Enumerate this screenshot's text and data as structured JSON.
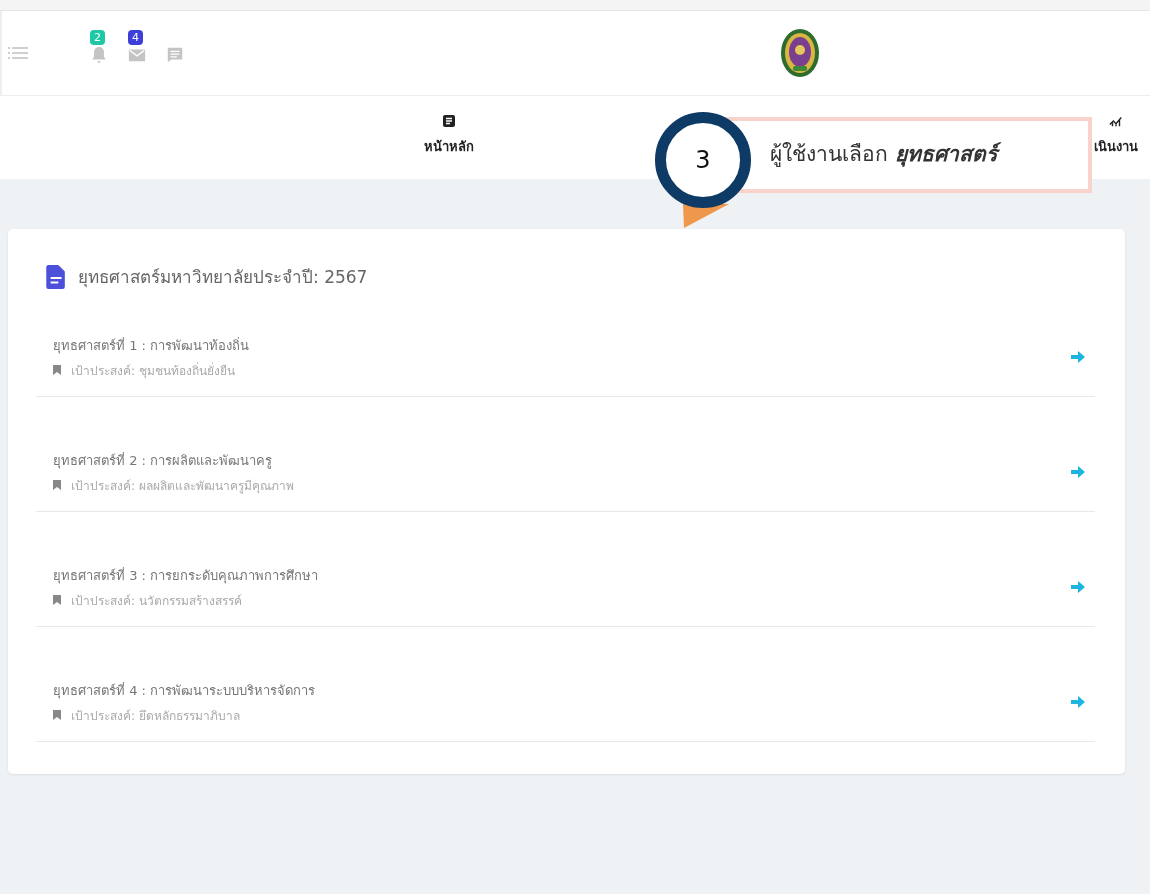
{
  "header": {
    "notifications": [
      {
        "kind": "bell",
        "count": "2",
        "color": "#1ec8a5"
      },
      {
        "kind": "mail",
        "count": "4",
        "color": "#3d3fd8"
      },
      {
        "kind": "chat"
      }
    ]
  },
  "nav": {
    "items": [
      {
        "label": "หน้าหลัก",
        "kind": "home"
      },
      {
        "label": "เนินงาน",
        "kind": "chart"
      }
    ]
  },
  "callout": {
    "number": "3",
    "text": "ผู้ใช้งานเลือก **ยุทธศาสตร์**"
  },
  "card": {
    "title": "ยุทธศาสตร์มหาวิทยาลัยประจำปี: 2567",
    "items": [
      {
        "title": "ยุทธศาสตร์ที่ 1 : การพัฒนาท้องถิ่น",
        "goal": "เป้าประสงค์: ชุมชนท้องถิ่นยั่งยืน"
      },
      {
        "title": "ยุทธศาสตร์ที่ 2 : การผลิตและพัฒนาครู",
        "goal": "เป้าประสงค์: ผลผลิตและพัฒนาครูมีคุณภาพ"
      },
      {
        "title": "ยุทธศาสตร์ที่ 3 : การยกระดับคุณภาพการศึกษา",
        "goal": "เป้าประสงค์: นวัตกรรมสร้างสรรค์"
      },
      {
        "title": "ยุทธศาสตร์ที่ 4 : การพัฒนาระบบบริหารจัดการ",
        "goal": "เป้าประสงค์: ยึดหลักธรรมาภิบาล"
      }
    ]
  }
}
